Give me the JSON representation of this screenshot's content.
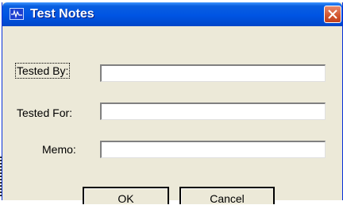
{
  "window": {
    "title": "Test Notes",
    "colors": {
      "titlebar": "#0054e3",
      "close_button": "#d2552e",
      "body": "#ece9d8"
    }
  },
  "form": {
    "tested_by_label": "Tested By:",
    "tested_by_value": "",
    "tested_for_label": "Tested For:",
    "tested_for_value": "",
    "memo_label": "Memo:",
    "memo_value": ""
  },
  "buttons": {
    "ok_label": "OK",
    "cancel_label": "Cancel"
  },
  "icons": {
    "app": "waveform-icon",
    "close": "close-icon"
  }
}
